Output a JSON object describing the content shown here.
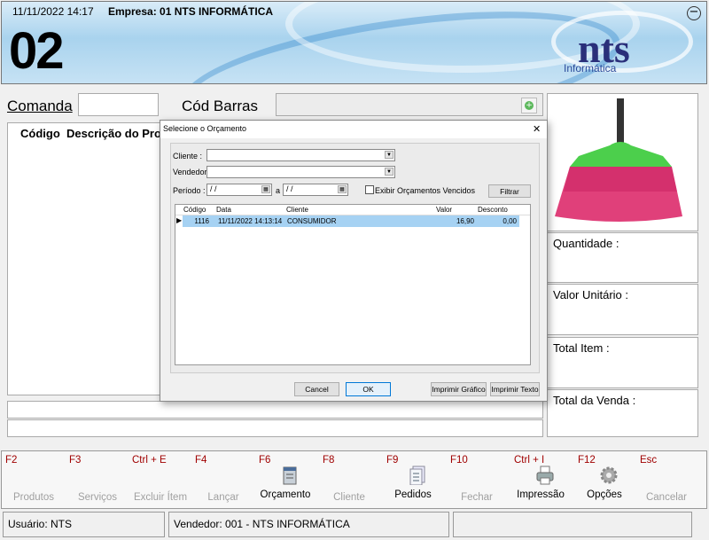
{
  "header": {
    "datetime": "11/11/2022 14:17",
    "empresa": "Empresa: 01 NTS INFORMÁTICA",
    "terminal": "02",
    "logo": "nts",
    "logo_sub": "Informática",
    "minimize": "−"
  },
  "form": {
    "comanda_label": "Comanda",
    "comanda_value": "",
    "barcode_label": "Cód Barras",
    "barcode_value": ""
  },
  "grid": {
    "columns": [
      "Código",
      "Descrição do Pro"
    ]
  },
  "summary": {
    "quantidade": "Quantidade :",
    "valor_unitario": "Valor Unitário :",
    "total_item": "Total Item :",
    "total_venda": "Total da Venda :"
  },
  "dialog": {
    "title": "Selecione o Orçamento",
    "close": "✕",
    "cliente_label": "Cliente :",
    "cliente_value": "",
    "vendedor_label": "Vendedor:",
    "vendedor_value": "",
    "periodo_label": "Período :",
    "periodo_from": " / /",
    "periodo_sep": "a",
    "periodo_to": " / /",
    "vencidos_label": "Exibir Orçamentos Vencidos",
    "vencidos_checked": false,
    "filtrar": "Filtrar",
    "columns": [
      "Código",
      "Data",
      "Cliente",
      "Valor",
      "Desconto"
    ],
    "rows": [
      {
        "codigo": "1116",
        "data": "11/11/2022 14:13:14",
        "cliente": "CONSUMIDOR",
        "valor": "16,90",
        "desconto": "0,00"
      }
    ],
    "cancel": "Cancel",
    "ok": "OK",
    "imprimir_grafico": "Imprimir Gráfico",
    "imprimir_texto": "Imprimir Texto"
  },
  "toolbar": [
    {
      "key": "F2",
      "label": "Produtos",
      "enabled": false
    },
    {
      "key": "F3",
      "label": "Serviços",
      "enabled": false
    },
    {
      "key": "Ctrl + E",
      "label": "Excluir Ítem",
      "enabled": false
    },
    {
      "key": "F4",
      "label": "Lançar",
      "enabled": false
    },
    {
      "key": "F6",
      "label": "Orçamento",
      "enabled": true,
      "icon": "document-icon"
    },
    {
      "key": "F8",
      "label": "Cliente",
      "enabled": false
    },
    {
      "key": "F9",
      "label": "Pedidos",
      "enabled": true,
      "icon": "list-icon"
    },
    {
      "key": "F10",
      "label": "Fechar",
      "enabled": false
    },
    {
      "key": "Ctrl + I",
      "label": "Impressão",
      "enabled": true,
      "icon": "printer-icon"
    },
    {
      "key": "F12",
      "label": "Opções",
      "enabled": true,
      "icon": "gear-icon"
    },
    {
      "key": "Esc",
      "label": "Cancelar",
      "enabled": false
    }
  ],
  "status": {
    "usuario": "Usuário: NTS",
    "vendedor": "Vendedor: 001 - NTS INFORMÁTICA",
    "extra": ""
  },
  "colors": {
    "selection": "#a6d2f3",
    "fkey": "#a00000",
    "disabled": "#a0a0a0"
  }
}
